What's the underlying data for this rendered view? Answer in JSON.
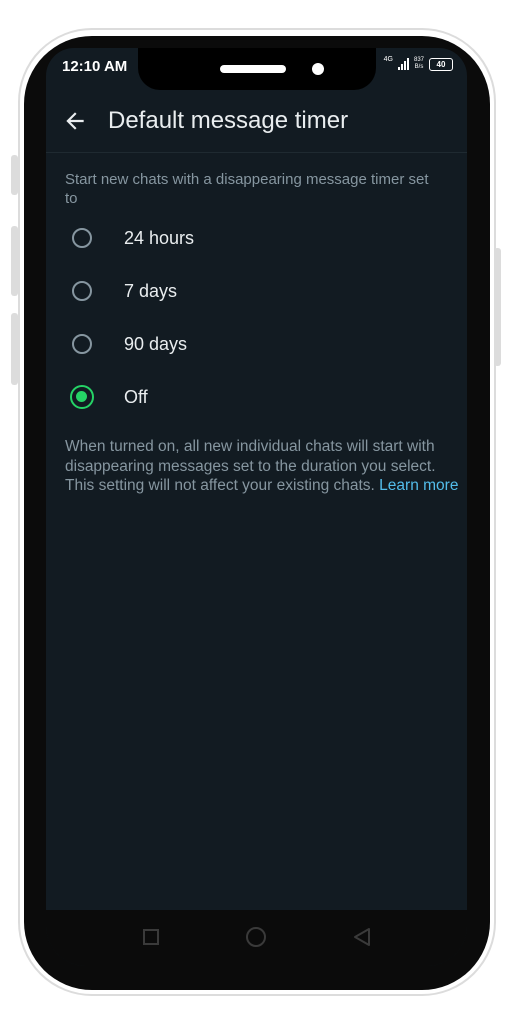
{
  "status_bar": {
    "time": "12:10 AM",
    "network_type": "4G",
    "speed_value": "837",
    "speed_unit": "B/s",
    "battery": "40"
  },
  "header": {
    "back_icon": "arrow-left-icon",
    "title": "Default message timer"
  },
  "subtitle": "Start new chats with a disappearing message timer set to",
  "options": [
    {
      "label": "24 hours",
      "selected": false
    },
    {
      "label": "7 days",
      "selected": false
    },
    {
      "label": "90 days",
      "selected": false
    },
    {
      "label": "Off",
      "selected": true
    }
  ],
  "description": {
    "text": "When turned on, all new individual chats will start with disappearing messages set to the duration you select. This setting will not affect your existing chats.",
    "link": "Learn more"
  },
  "nav_bar": {
    "recents_icon": "square-icon",
    "home_icon": "circle-icon",
    "back_icon": "triangle-back-icon"
  },
  "colors": {
    "background": "#121b22",
    "accent": "#25d366",
    "link": "#53bdeb",
    "primary_text": "#e9edef",
    "secondary_text": "#8696a0"
  }
}
